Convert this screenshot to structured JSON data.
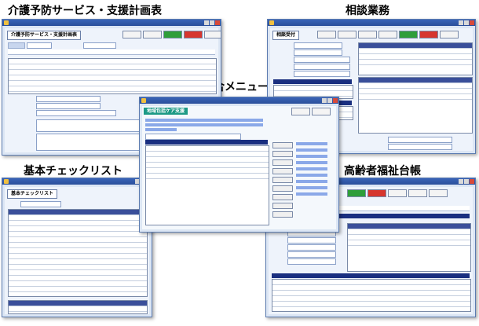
{
  "captions": {
    "care_plan": "介護予防サービス・支援計画表",
    "consultation": "相談業務",
    "main_menu": "総合メニュー",
    "checklist": "基本チェックリスト",
    "elderly_ledger": "高齢者福祉台帳"
  },
  "care_plan_window": {
    "header": "介護予防サービス・支援計画表"
  },
  "consultation_window": {
    "header": "相談受付"
  },
  "menu_window": {
    "app_title": "地域包括ケア支援"
  },
  "checklist_window": {
    "header": "基本チェックリスト"
  },
  "ledger_window": {
    "header": ""
  },
  "icons": {
    "window_icon": "app-window-icon",
    "close": "close-icon",
    "minimize": "minimize-icon",
    "maximize": "maximize-icon"
  },
  "colors": {
    "titlebar": "#2a4f9a",
    "window_bg": "#dce6f4",
    "menu_accent": "#1d9a86",
    "ok_green": "#2f9e3a",
    "alert_red": "#d6362e"
  }
}
